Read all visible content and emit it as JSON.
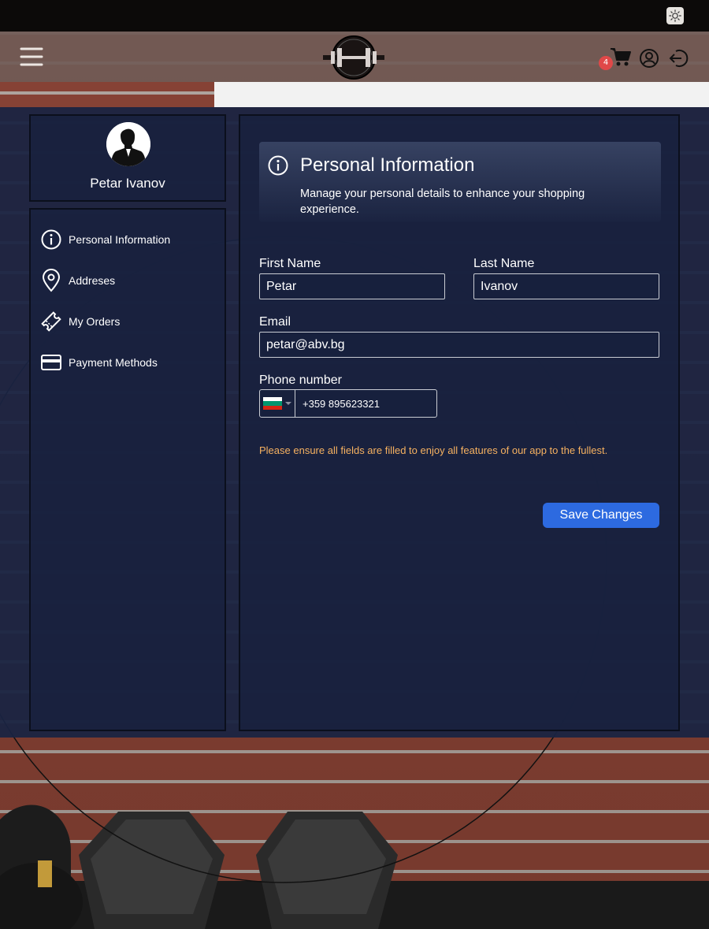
{
  "header": {
    "cart_count": "4"
  },
  "profile": {
    "name": "Petar Ivanov"
  },
  "sidebar": {
    "items": [
      {
        "label": "Personal Information",
        "icon": "info-icon"
      },
      {
        "label": "Addreses",
        "icon": "location-pin-icon"
      },
      {
        "label": "My Orders",
        "icon": "ticket-icon"
      },
      {
        "label": "Payment Methods",
        "icon": "credit-card-icon"
      }
    ]
  },
  "section": {
    "title": "Personal Information",
    "description": "Manage your personal details to enhance your shopping experience."
  },
  "form": {
    "first_name_label": "First Name",
    "first_name_value": "Petar",
    "last_name_label": "Last Name",
    "last_name_value": "Ivanov",
    "email_label": "Email",
    "email_value": "petar@abv.bg",
    "phone_label": "Phone number",
    "phone_value": "+359 895623321",
    "phone_country": "BG",
    "warning": "Please ensure all fields are filled to enjoy all features of our app to the fullest.",
    "save_label": "Save Changes"
  },
  "colors": {
    "accent": "#2d6ae0",
    "warning": "#f6b160",
    "badge": "#e04848",
    "panel": "#1a2442"
  }
}
